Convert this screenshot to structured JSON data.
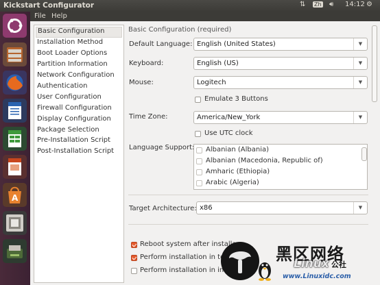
{
  "window": {
    "title": "Kickstart Configurator"
  },
  "topbar": {
    "ime": "Zh",
    "time": "14:12"
  },
  "menu": [
    "File",
    "Help"
  ],
  "launcher": [
    "ubuntu-dash-icon",
    "files-icon",
    "firefox-icon",
    "writer-icon",
    "calc-icon",
    "impress-icon",
    "software-center-icon",
    "kickstart-icon",
    "installer-icon"
  ],
  "sidebar": {
    "selected": "Basic Configuration",
    "items": [
      "Basic Configuration",
      "Installation Method",
      "Boot Loader Options",
      "Partition Information",
      "Network Configuration",
      "Authentication",
      "User Configuration",
      "Firewall Configuration",
      "Display Configuration",
      "Package Selection",
      "Pre-Installation Script",
      "Post-Installation Script"
    ]
  },
  "basic": {
    "section_title": "Basic Configuration (required)",
    "default_language_label": "Default Language:",
    "default_language_value": "English (United States)",
    "keyboard_label": "Keyboard:",
    "keyboard_value": "English (US)",
    "mouse_label": "Mouse:",
    "mouse_value": "Logitech",
    "emulate_3_buttons_label": "Emulate 3 Buttons",
    "emulate_3_buttons_checked": false,
    "time_zone_label": "Time Zone:",
    "time_zone_value": "America/New_York",
    "use_utc_label": "Use UTC clock",
    "use_utc_checked": false,
    "language_support_label": "Language Support:",
    "languages": [
      {
        "name": "Albanian (Albania)",
        "checked": false
      },
      {
        "name": "Albanian (Macedonia, Republic of)",
        "checked": false
      },
      {
        "name": "Amharic (Ethiopia)",
        "checked": false
      },
      {
        "name": "Arabic (Algeria)",
        "checked": false
      }
    ],
    "target_architecture_label": "Target Architecture:",
    "target_architecture_value": "x86",
    "reboot_label": "Reboot system after installa",
    "reboot_checked": true,
    "text_mode_label": "Perform installation in te",
    "text_mode_checked": true,
    "interactive_label": "Perform installation in int",
    "interactive_checked": false
  },
  "watermark": {
    "cn_text": "黑区网络",
    "brand": "Linux",
    "brand_suffix": "公社",
    "site": "www.Linuxidc.com"
  },
  "colors": {
    "accent": "#e45a2c",
    "launcher_bg": "#4a2a3a",
    "topbar_bg": "#3c3b37"
  }
}
